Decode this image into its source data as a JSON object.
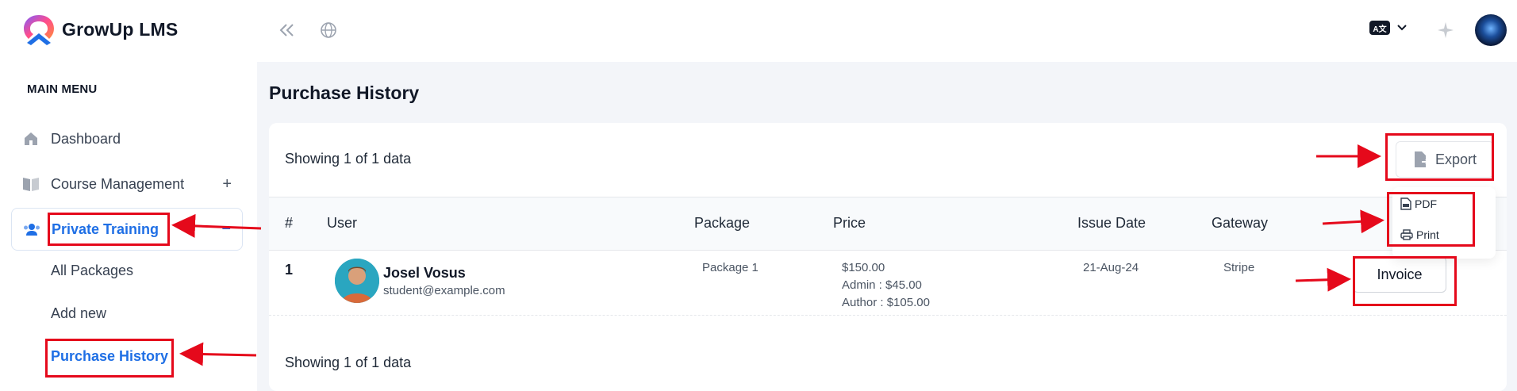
{
  "app": {
    "name": "GrowUp LMS"
  },
  "sidebar": {
    "heading": "MAIN MENU",
    "items": [
      {
        "label": "Dashboard",
        "icon": "home-icon"
      },
      {
        "label": "Course Management",
        "icon": "book-icon",
        "toggle": "+"
      },
      {
        "label": "Private Training",
        "icon": "users-icon",
        "toggle": "−"
      }
    ],
    "sub_items": [
      {
        "label": "All Packages"
      },
      {
        "label": "Add new"
      },
      {
        "label": "Purchase History"
      }
    ]
  },
  "topbar": {
    "collapse_icon": "chevrons-left-icon",
    "globe_icon": "globe-icon",
    "language_badge": "A文",
    "sparkle_icon": "sparkle-icon"
  },
  "page": {
    "title": "Purchase History"
  },
  "table": {
    "showing_top": "Showing 1 of 1 data",
    "showing_bottom": "Showing 1 of 1 data",
    "export_label": "Export",
    "export_menu": {
      "pdf": "PDF",
      "print": "Print"
    },
    "columns": {
      "num": "#",
      "user": "User",
      "package": "Package",
      "price": "Price",
      "issue_date": "Issue Date",
      "gateway": "Gateway"
    },
    "rows": [
      {
        "num": "1",
        "user_name": "Josel Vosus",
        "user_email": "student@example.com",
        "package": "Package 1",
        "price": "$150.00",
        "admin": "Admin : $45.00",
        "author": "Author : $105.00",
        "issue_date": "21-Aug-24",
        "gateway": "Stripe",
        "action": "Invoice"
      }
    ]
  },
  "colors": {
    "accent": "#1f6fe5",
    "annotation": "#e5091b",
    "background": "#f3f5f9"
  }
}
